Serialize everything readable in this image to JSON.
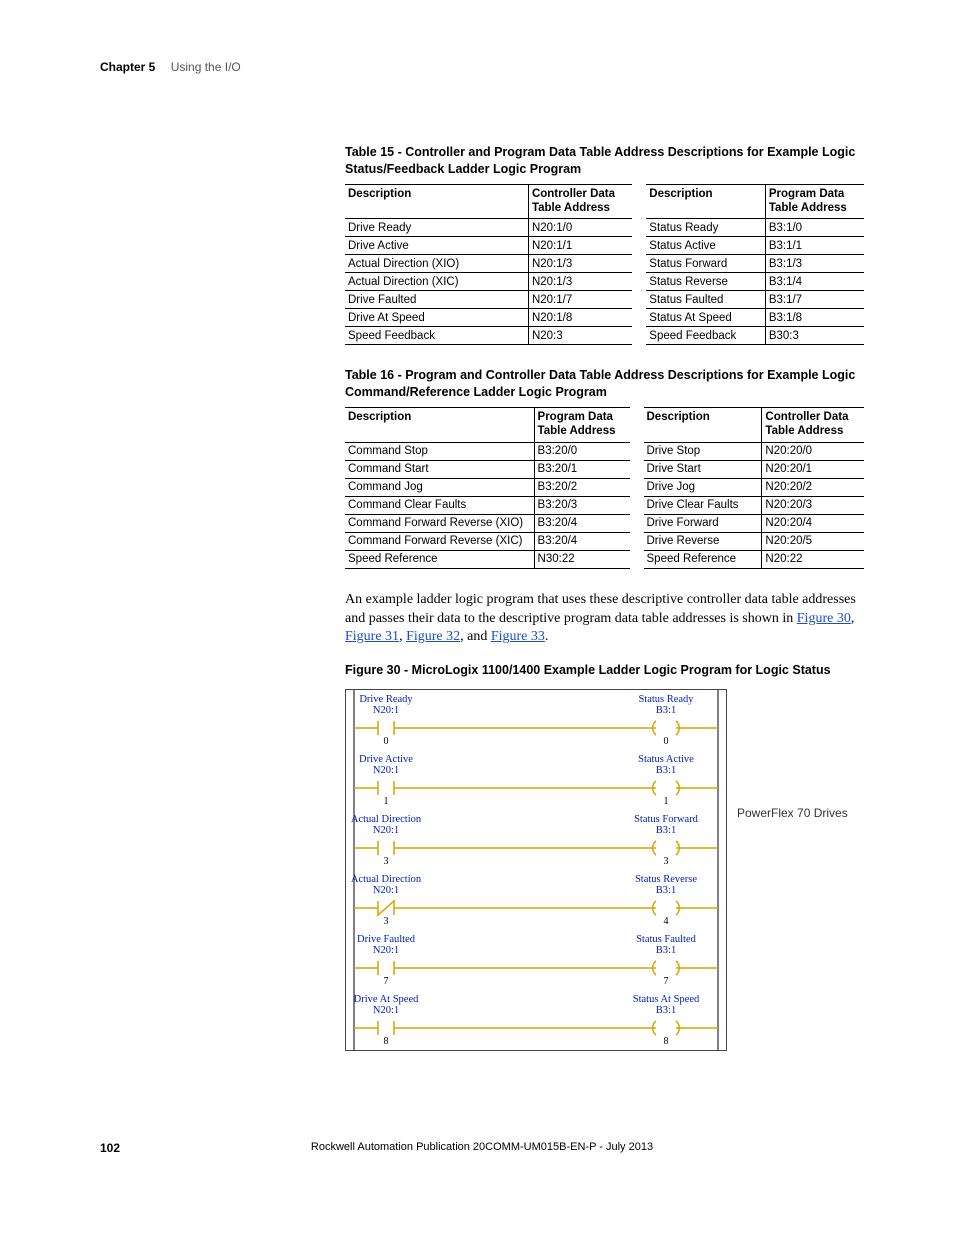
{
  "header": {
    "chapter": "Chapter 5",
    "title": "Using the I/O"
  },
  "table15": {
    "title": "Table 15 - Controller and Program Data Table Address Descriptions for Example Logic Status/Feedback Ladder Logic Program",
    "left": {
      "head": [
        "Description",
        "Controller Data Table Address"
      ],
      "rows": [
        [
          "Drive Ready",
          "N20:1/0"
        ],
        [
          "Drive Active",
          "N20:1/1"
        ],
        [
          "Actual Direction (XIO)",
          "N20:1/3"
        ],
        [
          "Actual Direction (XIC)",
          "N20:1/3"
        ],
        [
          "Drive Faulted",
          "N20:1/7"
        ],
        [
          "Drive At Speed",
          "N20:1/8"
        ],
        [
          "Speed Feedback",
          "N20:3"
        ]
      ]
    },
    "right": {
      "head": [
        "Description",
        "Program Data Table Address"
      ],
      "rows": [
        [
          "Status Ready",
          "B3:1/0"
        ],
        [
          "Status Active",
          "B3:1/1"
        ],
        [
          "Status Forward",
          "B3:1/3"
        ],
        [
          "Status Reverse",
          "B3:1/4"
        ],
        [
          "Status Faulted",
          "B3:1/7"
        ],
        [
          "Status At Speed",
          "B3:1/8"
        ],
        [
          "Speed Feedback",
          "B30:3"
        ]
      ]
    }
  },
  "table16": {
    "title": "Table 16 - Program and Controller Data Table Address Descriptions for Example Logic Command/Reference Ladder Logic Program",
    "left": {
      "head": [
        "Description",
        "Program Data Table Address"
      ],
      "rows": [
        [
          "Command Stop",
          "B3:20/0"
        ],
        [
          "Command Start",
          "B3:20/1"
        ],
        [
          "Command Jog",
          "B3:20/2"
        ],
        [
          "Command Clear Faults",
          "B3:20/3"
        ],
        [
          "Command Forward Reverse (XIO)",
          "B3:20/4"
        ],
        [
          "Command Forward Reverse (XIC)",
          "B3:20/4"
        ],
        [
          "Speed Reference",
          "N30:22"
        ]
      ]
    },
    "right": {
      "head": [
        "Description",
        "Controller Data Table Address"
      ],
      "rows": [
        [
          "Drive Stop",
          "N20:20/0"
        ],
        [
          "Drive Start",
          "N20:20/1"
        ],
        [
          "Drive Jog",
          "N20:20/2"
        ],
        [
          "Drive Clear Faults",
          "N20:20/3"
        ],
        [
          "Drive Forward",
          "N20:20/4"
        ],
        [
          "Drive Reverse",
          "N20:20/5"
        ],
        [
          "Speed Reference",
          "N20:22"
        ]
      ]
    }
  },
  "paragraph": {
    "t1": "An example ladder logic program that uses these descriptive controller data table addresses and passes their data to the descriptive program data table addresses is shown in ",
    "l1": "Figure 30",
    "s1": ", ",
    "l2": "Figure 31",
    "s2": ", ",
    "l3": "Figure 32",
    "s3": ", and ",
    "l4": "Figure 33",
    "s4": "."
  },
  "figure30": {
    "title": "Figure 30 - MicroLogix 1100/1400 Example Ladder Logic Program for Logic Status",
    "side_note": "PowerFlex 70 Drives",
    "rungs": [
      {
        "left_label": "Drive Ready",
        "left_addr": "N20:1",
        "left_bit": "0",
        "xic": true,
        "right_label": "Status Ready",
        "right_addr": "B3:1",
        "right_bit": "0"
      },
      {
        "left_label": "Drive Active",
        "left_addr": "N20:1",
        "left_bit": "1",
        "xic": true,
        "right_label": "Status Active",
        "right_addr": "B3:1",
        "right_bit": "1"
      },
      {
        "left_label": "Actual Direction",
        "left_addr": "N20:1",
        "left_bit": "3",
        "xic": true,
        "right_label": "Status Forward",
        "right_addr": "B3:1",
        "right_bit": "3"
      },
      {
        "left_label": "Actual Direction",
        "left_addr": "N20:1",
        "left_bit": "3",
        "xic": false,
        "right_label": "Status Reverse",
        "right_addr": "B3:1",
        "right_bit": "4"
      },
      {
        "left_label": "Drive Faulted",
        "left_addr": "N20:1",
        "left_bit": "7",
        "xic": true,
        "right_label": "Status Faulted",
        "right_addr": "B3:1",
        "right_bit": "7"
      },
      {
        "left_label": "Drive At Speed",
        "left_addr": "N20:1",
        "left_bit": "8",
        "xic": true,
        "right_label": "Status At Speed",
        "right_addr": "B3:1",
        "right_bit": "8"
      }
    ]
  },
  "footer": {
    "page": "102",
    "pub": "Rockwell Automation Publication 20COMM-UM015B-EN-P - July 2013"
  }
}
